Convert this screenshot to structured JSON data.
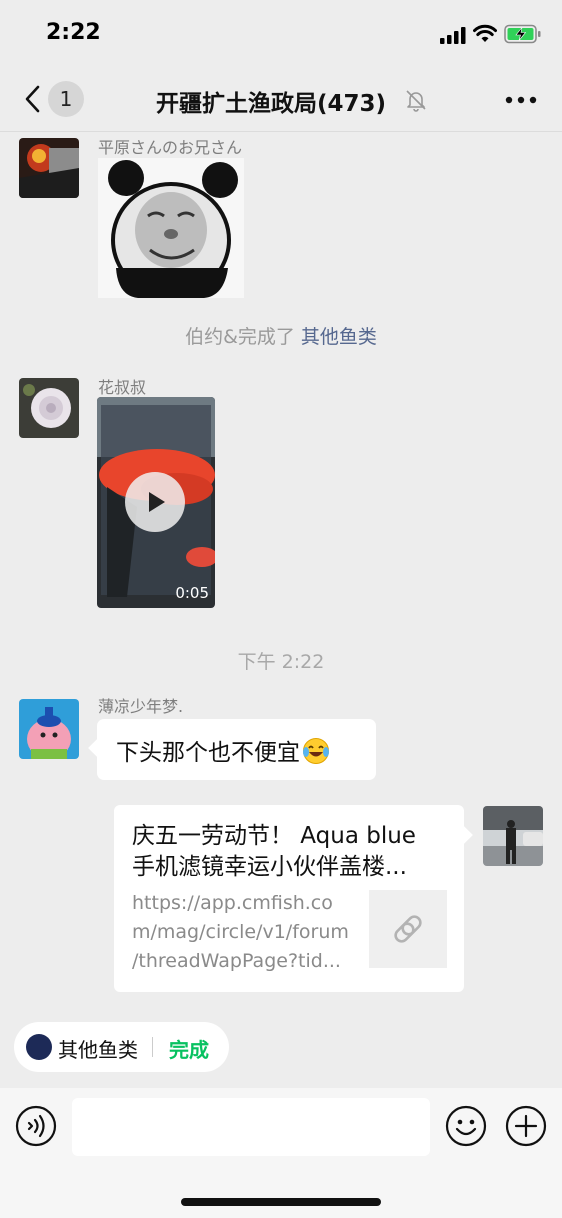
{
  "status_bar": {
    "time": "2:22"
  },
  "nav": {
    "back_badge": "1",
    "title": "开疆扩土渔政局(473)"
  },
  "messages": {
    "m1_sender": "平原さんのお兄さん",
    "sys1_text": "伯约&完成了 ",
    "sys1_link": "其他鱼类",
    "m2_sender": "花叔叔",
    "m2_duration": "0:05",
    "timestamp": "下午 2:22",
    "m3_sender": "薄凉少年梦.",
    "m3_text": "下头那个也不便宜",
    "card_title_line1": "庆五一劳动节！ Aqua blue",
    "card_title_line2": "手机滤镜幸运小伙伴盖楼...",
    "card_url_line1": "https://app.cmfish.co",
    "card_url_line2": "m/mag/circle/v1/forum",
    "card_url_line3": "/threadWapPage?tid..."
  },
  "quick_bar": {
    "chip_label": "其他鱼类",
    "chip_action": "完成"
  },
  "icons": {
    "back": "chevron-left-icon",
    "mute": "bell-slash-icon",
    "more": "more-icon",
    "voice": "voice-icon",
    "emoji": "emoji-icon",
    "add": "plus-icon",
    "link": "link-icon",
    "play": "play-icon"
  },
  "colors": {
    "accent_green": "#07c160",
    "link_blue": "#56688f",
    "background": "#ededed"
  }
}
